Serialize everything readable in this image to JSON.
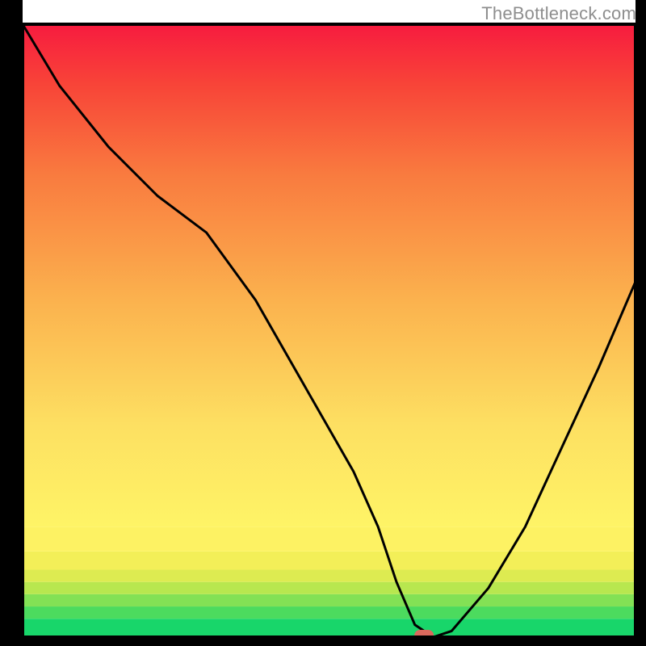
{
  "watermark": "TheBottleneck.com",
  "chart_data": {
    "type": "line",
    "title": "",
    "xlabel": "",
    "ylabel": "",
    "xlim": [
      0,
      100
    ],
    "ylim": [
      0,
      100
    ],
    "x": [
      0,
      6,
      14,
      22,
      30,
      38,
      46,
      54,
      58,
      61,
      64,
      67,
      70,
      76,
      82,
      88,
      94,
      100
    ],
    "values": [
      100,
      90,
      80,
      72,
      66,
      55,
      41,
      27,
      18,
      9,
      2,
      0,
      1,
      8,
      18,
      31,
      44,
      58
    ],
    "marker": {
      "x": 65.5,
      "y": 0
    },
    "gradient_bands": [
      {
        "y0": 0,
        "y1": 3,
        "color": "#18d66a"
      },
      {
        "y0": 3,
        "y1": 5,
        "color": "#4cdb5e"
      },
      {
        "y0": 5,
        "y1": 7,
        "color": "#83e155"
      },
      {
        "y0": 7,
        "y1": 9,
        "color": "#b8e74f"
      },
      {
        "y0": 9,
        "y1": 11,
        "color": "#ddeb51"
      },
      {
        "y0": 11,
        "y1": 14,
        "color": "#f3ef58"
      },
      {
        "y0": 14,
        "y1": 18,
        "color": "#fdf263"
      },
      {
        "y0": 18,
        "y1": 100,
        "color": "gradient"
      }
    ]
  }
}
